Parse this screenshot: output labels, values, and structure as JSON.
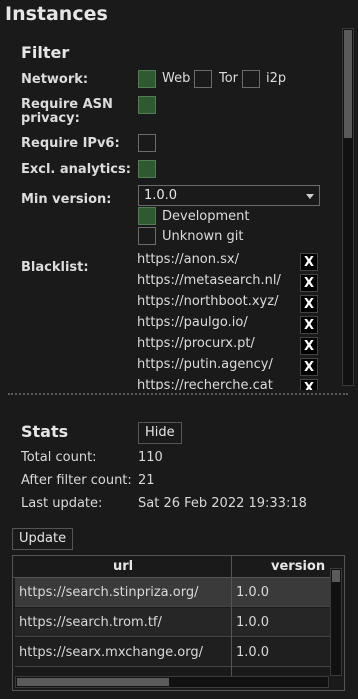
{
  "title": "Instances",
  "filter": {
    "title": "Filter",
    "network_label": "Network:",
    "network_options": [
      {
        "label": "Web",
        "checked": true
      },
      {
        "label": "Tor",
        "checked": false
      },
      {
        "label": "i2p",
        "checked": false
      }
    ],
    "asn_label_line1": "Require ASN",
    "asn_label_line2": "privacy:",
    "asn_checked": true,
    "ipv6_label": "Require IPv6:",
    "ipv6_checked": false,
    "analytics_label": "Excl. analytics:",
    "analytics_checked": true,
    "min_version_label": "Min version:",
    "min_version_value": "1.0.0",
    "development_label": "Development",
    "development_checked": true,
    "unknown_git_label": "Unknown git",
    "unknown_git_checked": false,
    "blacklist_label": "Blacklist:",
    "blacklist": [
      "https://anon.sx/",
      "https://metasearch.nl/",
      "https://northboot.xyz/",
      "https://paulgo.io/",
      "https://procurx.pt/",
      "https://putin.agency/",
      "https://recherche.cat"
    ],
    "remove_label": "X"
  },
  "stats": {
    "title": "Stats",
    "hide_label": "Hide",
    "total_label": "Total count:",
    "total_value": "110",
    "after_label": "After filter count:",
    "after_value": "21",
    "update_label": "Last update:",
    "update_value": "Sat 26 Feb 2022 19:33:18"
  },
  "update_button": "Update",
  "table": {
    "columns": [
      "url",
      "version"
    ],
    "rows": [
      {
        "url": "https://search.stinpriza.org/",
        "version": "1.0.0"
      },
      {
        "url": "https://search.trom.tf/",
        "version": "1.0.0"
      },
      {
        "url": "https://searx.mxchange.org/",
        "version": "1.0.0"
      }
    ]
  }
}
